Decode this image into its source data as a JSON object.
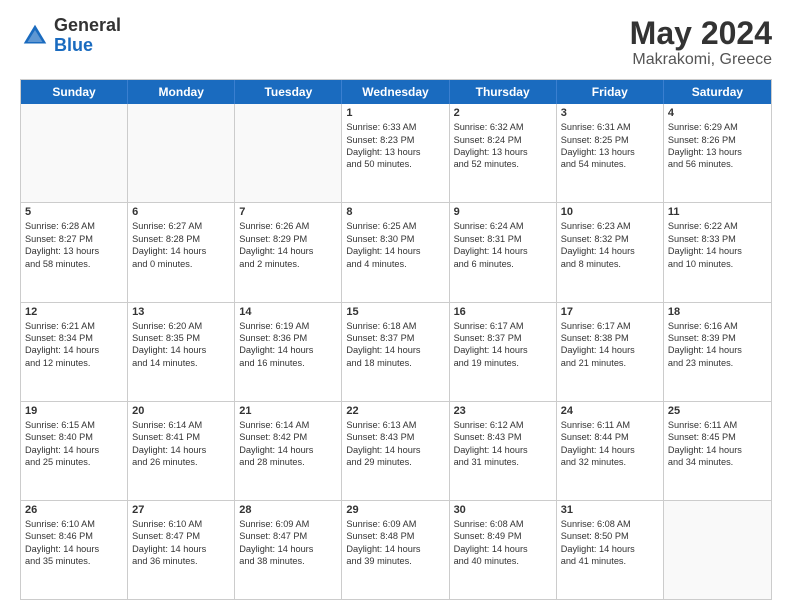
{
  "header": {
    "logo_general": "General",
    "logo_blue": "Blue",
    "title": "May 2024",
    "subtitle": "Makrakomi, Greece"
  },
  "days_of_week": [
    "Sunday",
    "Monday",
    "Tuesday",
    "Wednesday",
    "Thursday",
    "Friday",
    "Saturday"
  ],
  "weeks": [
    [
      {
        "num": "",
        "lines": [],
        "empty": true
      },
      {
        "num": "",
        "lines": [],
        "empty": true
      },
      {
        "num": "",
        "lines": [],
        "empty": true
      },
      {
        "num": "1",
        "lines": [
          "Sunrise: 6:33 AM",
          "Sunset: 8:23 PM",
          "Daylight: 13 hours",
          "and 50 minutes."
        ],
        "empty": false
      },
      {
        "num": "2",
        "lines": [
          "Sunrise: 6:32 AM",
          "Sunset: 8:24 PM",
          "Daylight: 13 hours",
          "and 52 minutes."
        ],
        "empty": false
      },
      {
        "num": "3",
        "lines": [
          "Sunrise: 6:31 AM",
          "Sunset: 8:25 PM",
          "Daylight: 13 hours",
          "and 54 minutes."
        ],
        "empty": false
      },
      {
        "num": "4",
        "lines": [
          "Sunrise: 6:29 AM",
          "Sunset: 8:26 PM",
          "Daylight: 13 hours",
          "and 56 minutes."
        ],
        "empty": false
      }
    ],
    [
      {
        "num": "5",
        "lines": [
          "Sunrise: 6:28 AM",
          "Sunset: 8:27 PM",
          "Daylight: 13 hours",
          "and 58 minutes."
        ],
        "empty": false
      },
      {
        "num": "6",
        "lines": [
          "Sunrise: 6:27 AM",
          "Sunset: 8:28 PM",
          "Daylight: 14 hours",
          "and 0 minutes."
        ],
        "empty": false
      },
      {
        "num": "7",
        "lines": [
          "Sunrise: 6:26 AM",
          "Sunset: 8:29 PM",
          "Daylight: 14 hours",
          "and 2 minutes."
        ],
        "empty": false
      },
      {
        "num": "8",
        "lines": [
          "Sunrise: 6:25 AM",
          "Sunset: 8:30 PM",
          "Daylight: 14 hours",
          "and 4 minutes."
        ],
        "empty": false
      },
      {
        "num": "9",
        "lines": [
          "Sunrise: 6:24 AM",
          "Sunset: 8:31 PM",
          "Daylight: 14 hours",
          "and 6 minutes."
        ],
        "empty": false
      },
      {
        "num": "10",
        "lines": [
          "Sunrise: 6:23 AM",
          "Sunset: 8:32 PM",
          "Daylight: 14 hours",
          "and 8 minutes."
        ],
        "empty": false
      },
      {
        "num": "11",
        "lines": [
          "Sunrise: 6:22 AM",
          "Sunset: 8:33 PM",
          "Daylight: 14 hours",
          "and 10 minutes."
        ],
        "empty": false
      }
    ],
    [
      {
        "num": "12",
        "lines": [
          "Sunrise: 6:21 AM",
          "Sunset: 8:34 PM",
          "Daylight: 14 hours",
          "and 12 minutes."
        ],
        "empty": false
      },
      {
        "num": "13",
        "lines": [
          "Sunrise: 6:20 AM",
          "Sunset: 8:35 PM",
          "Daylight: 14 hours",
          "and 14 minutes."
        ],
        "empty": false
      },
      {
        "num": "14",
        "lines": [
          "Sunrise: 6:19 AM",
          "Sunset: 8:36 PM",
          "Daylight: 14 hours",
          "and 16 minutes."
        ],
        "empty": false
      },
      {
        "num": "15",
        "lines": [
          "Sunrise: 6:18 AM",
          "Sunset: 8:37 PM",
          "Daylight: 14 hours",
          "and 18 minutes."
        ],
        "empty": false
      },
      {
        "num": "16",
        "lines": [
          "Sunrise: 6:17 AM",
          "Sunset: 8:37 PM",
          "Daylight: 14 hours",
          "and 19 minutes."
        ],
        "empty": false
      },
      {
        "num": "17",
        "lines": [
          "Sunrise: 6:17 AM",
          "Sunset: 8:38 PM",
          "Daylight: 14 hours",
          "and 21 minutes."
        ],
        "empty": false
      },
      {
        "num": "18",
        "lines": [
          "Sunrise: 6:16 AM",
          "Sunset: 8:39 PM",
          "Daylight: 14 hours",
          "and 23 minutes."
        ],
        "empty": false
      }
    ],
    [
      {
        "num": "19",
        "lines": [
          "Sunrise: 6:15 AM",
          "Sunset: 8:40 PM",
          "Daylight: 14 hours",
          "and 25 minutes."
        ],
        "empty": false
      },
      {
        "num": "20",
        "lines": [
          "Sunrise: 6:14 AM",
          "Sunset: 8:41 PM",
          "Daylight: 14 hours",
          "and 26 minutes."
        ],
        "empty": false
      },
      {
        "num": "21",
        "lines": [
          "Sunrise: 6:14 AM",
          "Sunset: 8:42 PM",
          "Daylight: 14 hours",
          "and 28 minutes."
        ],
        "empty": false
      },
      {
        "num": "22",
        "lines": [
          "Sunrise: 6:13 AM",
          "Sunset: 8:43 PM",
          "Daylight: 14 hours",
          "and 29 minutes."
        ],
        "empty": false
      },
      {
        "num": "23",
        "lines": [
          "Sunrise: 6:12 AM",
          "Sunset: 8:43 PM",
          "Daylight: 14 hours",
          "and 31 minutes."
        ],
        "empty": false
      },
      {
        "num": "24",
        "lines": [
          "Sunrise: 6:11 AM",
          "Sunset: 8:44 PM",
          "Daylight: 14 hours",
          "and 32 minutes."
        ],
        "empty": false
      },
      {
        "num": "25",
        "lines": [
          "Sunrise: 6:11 AM",
          "Sunset: 8:45 PM",
          "Daylight: 14 hours",
          "and 34 minutes."
        ],
        "empty": false
      }
    ],
    [
      {
        "num": "26",
        "lines": [
          "Sunrise: 6:10 AM",
          "Sunset: 8:46 PM",
          "Daylight: 14 hours",
          "and 35 minutes."
        ],
        "empty": false
      },
      {
        "num": "27",
        "lines": [
          "Sunrise: 6:10 AM",
          "Sunset: 8:47 PM",
          "Daylight: 14 hours",
          "and 36 minutes."
        ],
        "empty": false
      },
      {
        "num": "28",
        "lines": [
          "Sunrise: 6:09 AM",
          "Sunset: 8:47 PM",
          "Daylight: 14 hours",
          "and 38 minutes."
        ],
        "empty": false
      },
      {
        "num": "29",
        "lines": [
          "Sunrise: 6:09 AM",
          "Sunset: 8:48 PM",
          "Daylight: 14 hours",
          "and 39 minutes."
        ],
        "empty": false
      },
      {
        "num": "30",
        "lines": [
          "Sunrise: 6:08 AM",
          "Sunset: 8:49 PM",
          "Daylight: 14 hours",
          "and 40 minutes."
        ],
        "empty": false
      },
      {
        "num": "31",
        "lines": [
          "Sunrise: 6:08 AM",
          "Sunset: 8:50 PM",
          "Daylight: 14 hours",
          "and 41 minutes."
        ],
        "empty": false
      },
      {
        "num": "",
        "lines": [],
        "empty": true
      }
    ]
  ]
}
